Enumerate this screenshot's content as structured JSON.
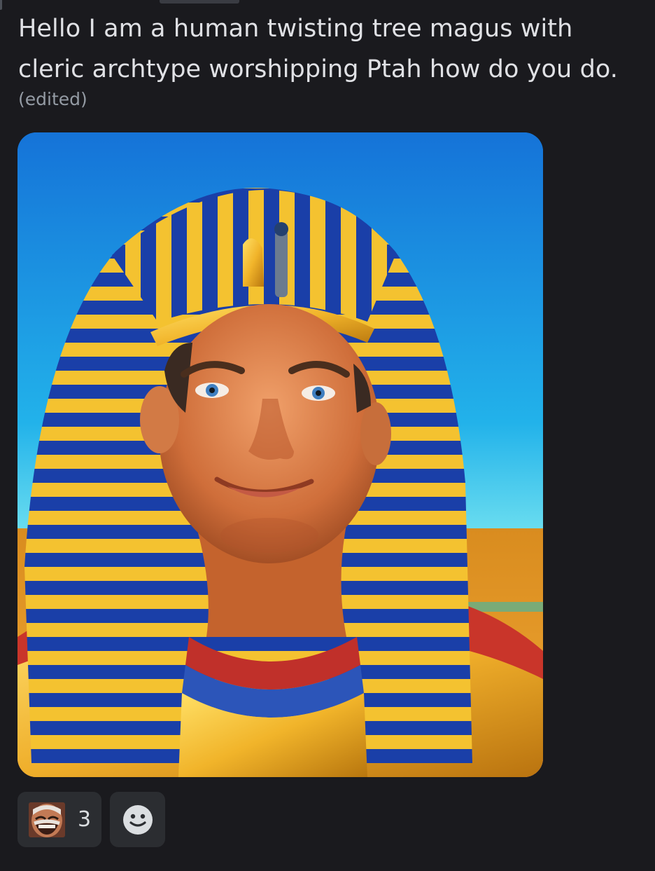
{
  "message": {
    "lines": [
      "Hello I am a human twisting tree magus with",
      "cleric archtype worshipping Ptah how do you do."
    ],
    "edited_label": "(edited)"
  },
  "attachment": {
    "type": "image",
    "subject": "pharaoh-portrait"
  },
  "reactions": [
    {
      "emoji": "laughing-man-face-emoji",
      "count": "3"
    }
  ],
  "add_reaction": {
    "icon": "smiley-add-reaction-icon"
  },
  "colors": {
    "background": "#1a1a1e",
    "message_text": "#e0e1e5",
    "muted_text": "#949ba4",
    "reaction_bg": "#2b2d31"
  }
}
